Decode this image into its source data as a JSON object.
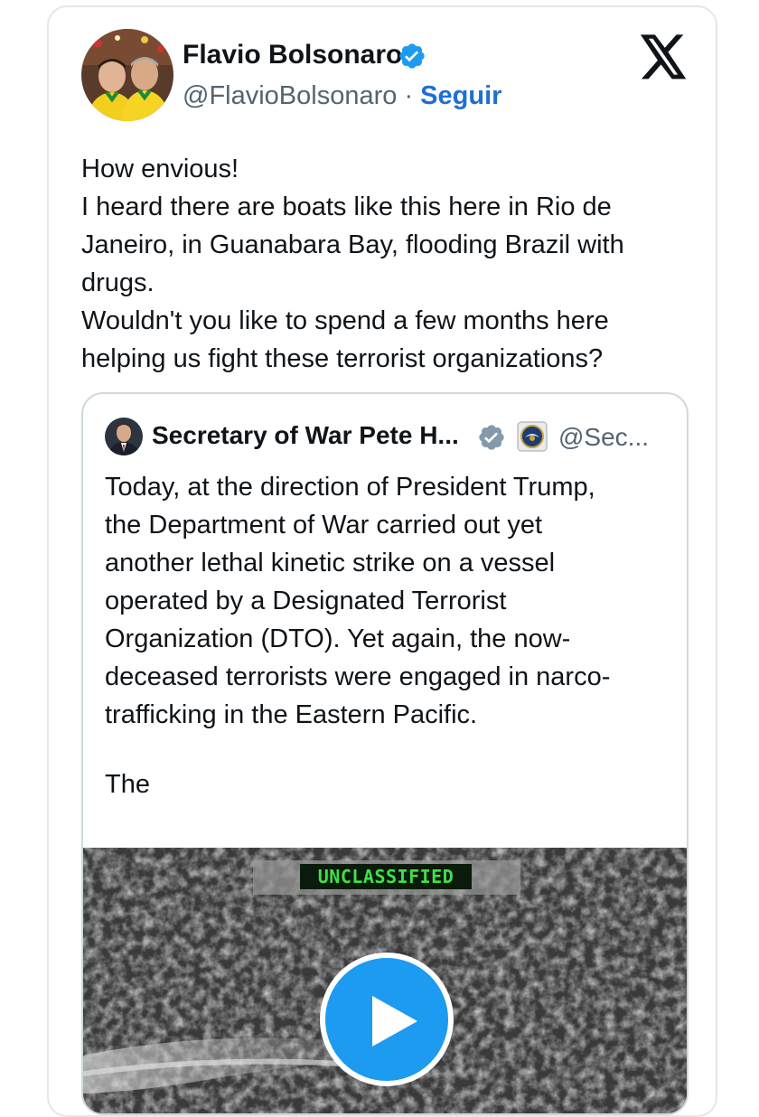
{
  "tweet": {
    "author_name": "Flavio Bolsonaro",
    "handle": "@FlavioBolsonaro",
    "separator": " · ",
    "follow_label": "Seguir",
    "text_lines": [
      "How envious!",
      "I heard there are boats like this here in Rio de",
      "Janeiro, in Guanabara Bay, flooding Brazil with",
      "drugs.",
      "Wouldn't you like to spend a few months here",
      "helping us fight these terrorist organizations?"
    ]
  },
  "quoted_tweet": {
    "author_name": "Secretary of War Pete H...",
    "handle": "@Sec...",
    "text_lines": [
      "Today, at the direction of President Trump,",
      "the Department of War carried out yet",
      "another lethal kinetic strike on a vessel",
      "operated by a Designated Terrorist",
      "Organization (DTO). Yet again, the now-",
      "deceased terrorists were engaged in narco-",
      "trafficking in the Eastern Pacific."
    ],
    "truncated_text": "The",
    "media": {
      "classification_label": "UNCLASSIFIED"
    }
  },
  "icons": {
    "verified": "verified-badge-icon",
    "x_logo": "x-logo-icon",
    "dod_seal": "department-seal-icon",
    "play": "play-icon"
  },
  "colors": {
    "link_blue": "#1d6fd6",
    "verified_blue": "#1d9bf0",
    "verified_gray": "#829aab",
    "secondary_text": "#536471",
    "classification_green": "#3fe04a"
  }
}
